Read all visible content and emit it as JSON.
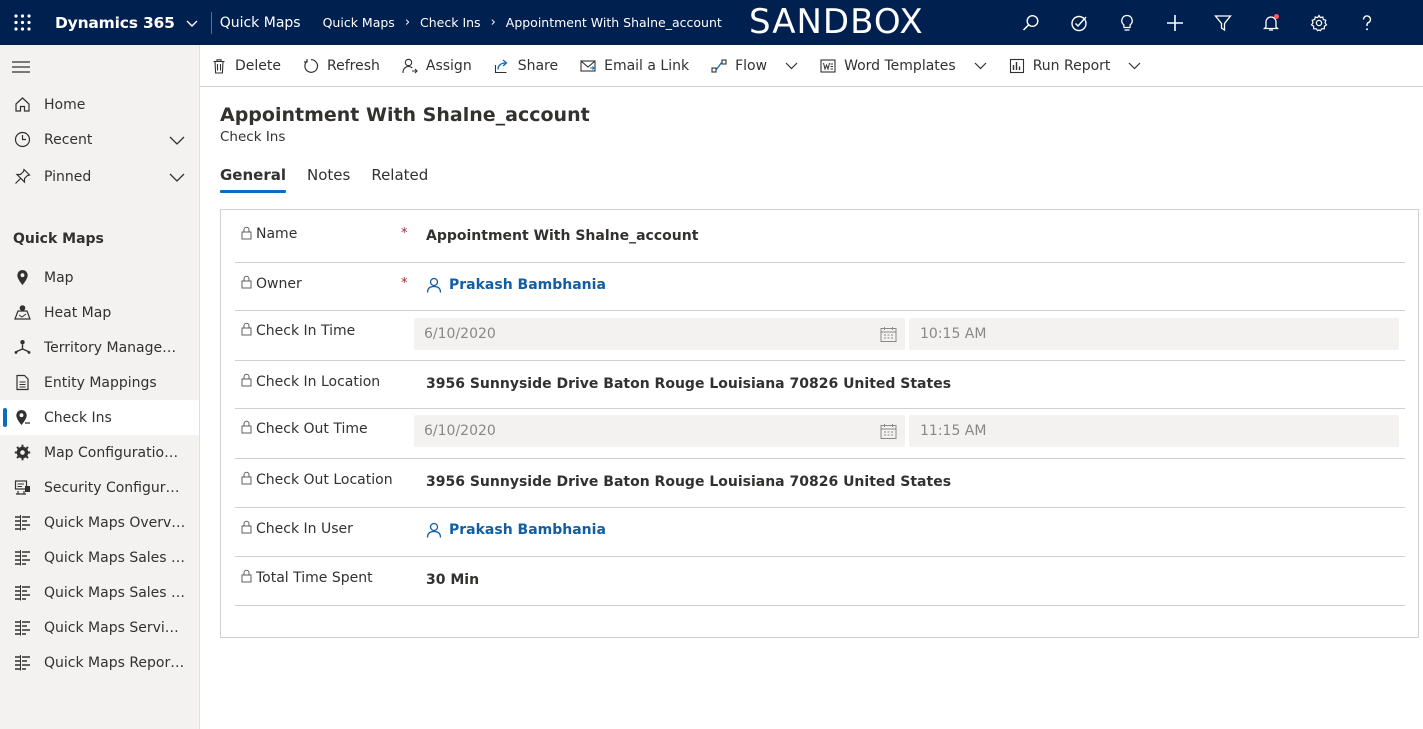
{
  "topbar": {
    "app_name": "Dynamics 365",
    "module": "Quick Maps",
    "breadcrumb": [
      "Quick Maps",
      "Check Ins",
      "Appointment With Shalne_account"
    ],
    "environment_banner": "SANDBOX",
    "icons": [
      "search-icon",
      "task-icon",
      "lightbulb-icon",
      "plus-icon",
      "filter-icon",
      "bell-icon",
      "gear-icon",
      "help-icon"
    ],
    "bar_color": "#002050"
  },
  "sidebar": {
    "top_items": [
      {
        "label": "Home",
        "icon": "home-icon"
      },
      {
        "label": "Recent",
        "icon": "clock-icon"
      },
      {
        "label": "Pinned",
        "icon": "pin-icon"
      }
    ],
    "group_title": "Quick Maps",
    "group_items": [
      {
        "label": "Map",
        "icon": "map-pin-icon"
      },
      {
        "label": "Heat Map",
        "icon": "heat-map-icon"
      },
      {
        "label": "Territory Management",
        "icon": "territory-icon"
      },
      {
        "label": "Entity Mappings",
        "icon": "document-icon"
      },
      {
        "label": "Check Ins",
        "icon": "check-in-pin-icon"
      },
      {
        "label": "Map Configuration D...",
        "icon": "gear-icon"
      },
      {
        "label": "Security Configuratio...",
        "icon": "security-config-icon"
      },
      {
        "label": "Quick Maps Overvie...",
        "icon": "dashboard-icon"
      },
      {
        "label": "Quick Maps Sales Act...",
        "icon": "dashboard-icon"
      },
      {
        "label": "Quick Maps Sales Per...",
        "icon": "dashboard-icon"
      },
      {
        "label": "Quick Maps Service ...",
        "icon": "dashboard-icon"
      },
      {
        "label": "Quick Maps Reportin...",
        "icon": "dashboard-icon"
      }
    ],
    "active_label": "Check Ins",
    "accent_color": "#0f6cbd"
  },
  "commands": [
    {
      "label": "Delete",
      "icon": "trash-icon"
    },
    {
      "label": "Refresh",
      "icon": "refresh-icon"
    },
    {
      "label": "Assign",
      "icon": "assign-icon"
    },
    {
      "label": "Share",
      "icon": "share-icon"
    },
    {
      "label": "Email a Link",
      "icon": "email-icon"
    },
    {
      "label": "Flow",
      "icon": "flow-icon"
    },
    {
      "label": "Word Templates",
      "icon": "word-icon"
    },
    {
      "label": "Run Report",
      "icon": "report-icon"
    }
  ],
  "form": {
    "title": "Appointment With Shalne_account",
    "entity": "Check Ins",
    "tabs": [
      "General",
      "Notes",
      "Related"
    ],
    "required_marker": "*",
    "fields": {
      "name": {
        "label": "Name",
        "value": "Appointment With Shalne_account"
      },
      "owner": {
        "label": "Owner",
        "value": "Prakash Bambhania"
      },
      "check_in_time": {
        "label": "Check In Time",
        "date": "6/10/2020",
        "time": "10:15 AM"
      },
      "check_in_location": {
        "label": "Check In Location",
        "value": "3956 Sunnyside Drive Baton Rouge Louisiana 70826 United States"
      },
      "check_out_time": {
        "label": "Check Out Time",
        "date": "6/10/2020",
        "time": "11:15 AM"
      },
      "check_out_location": {
        "label": "Check Out Location",
        "value": "3956 Sunnyside Drive Baton Rouge Louisiana 70826 United States"
      },
      "check_in_user": {
        "label": "Check In User",
        "value": "Prakash Bambhania"
      },
      "total_time_spent": {
        "label": "Total Time Spent",
        "value": "30 Min"
      }
    }
  }
}
